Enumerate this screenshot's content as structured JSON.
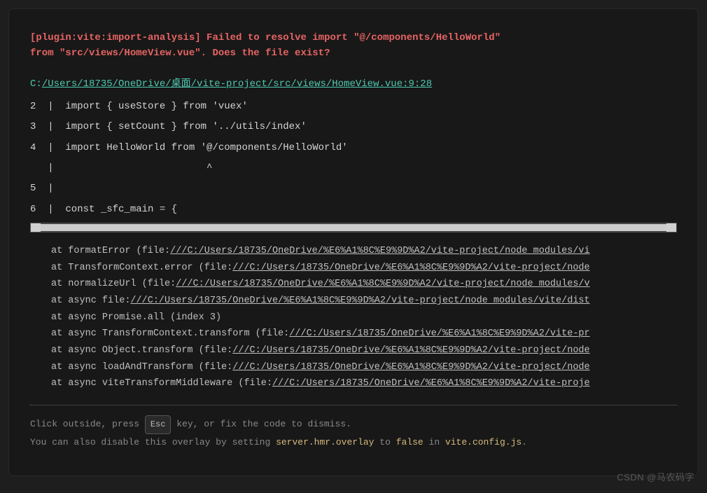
{
  "header": {
    "plugin_tag": "[plugin:vite:import-analysis]",
    "error_line1": " Failed to resolve import \"@/components/HelloWorld\"",
    "error_line2": "from \"src/views/HomeView.vue\". Does the file exist?"
  },
  "file": {
    "drive": "C:",
    "path": "/Users/18735/OneDrive/桌面/vite-project/src/views/HomeView.vue:9:28"
  },
  "code_frame": [
    {
      "num": "2",
      "text": "  import { useStore } from 'vuex'"
    },
    {
      "num": "3",
      "text": "  import { setCount } from '../utils/index'"
    },
    {
      "num": "4",
      "text": "  import HelloWorld from '@/components/HelloWorld'"
    },
    {
      "num": "",
      "text": "                          ^"
    },
    {
      "num": "5",
      "text": "  "
    },
    {
      "num": "6",
      "text": "  const _sfc_main = {"
    }
  ],
  "stack": [
    {
      "prefix": "at formatError (file:",
      "link": "///C:/Users/18735/OneDrive/%E6%A1%8C%E9%9D%A2/vite-project/node_modules/vi",
      "suffix": ""
    },
    {
      "prefix": "at TransformContext.error (file:",
      "link": "///C:/Users/18735/OneDrive/%E6%A1%8C%E9%9D%A2/vite-project/node",
      "suffix": ""
    },
    {
      "prefix": "at normalizeUrl (file:",
      "link": "///C:/Users/18735/OneDrive/%E6%A1%8C%E9%9D%A2/vite-project/node_modules/v",
      "suffix": ""
    },
    {
      "prefix": "at async file:",
      "link": "///C:/Users/18735/OneDrive/%E6%A1%8C%E9%9D%A2/vite-project/node_modules/vite/dist",
      "suffix": ""
    },
    {
      "prefix": "at async Promise.all (index 3)",
      "link": "",
      "suffix": ""
    },
    {
      "prefix": "at async TransformContext.transform (file:",
      "link": "///C:/Users/18735/OneDrive/%E6%A1%8C%E9%9D%A2/vite-pr",
      "suffix": ""
    },
    {
      "prefix": "at async Object.transform (file:",
      "link": "///C:/Users/18735/OneDrive/%E6%A1%8C%E9%9D%A2/vite-project/node",
      "suffix": ""
    },
    {
      "prefix": "at async loadAndTransform (file:",
      "link": "///C:/Users/18735/OneDrive/%E6%A1%8C%E9%9D%A2/vite-project/node",
      "suffix": ""
    },
    {
      "prefix": "at async viteTransformMiddleware (file:",
      "link": "///C:/Users/18735/OneDrive/%E6%A1%8C%E9%9D%A2/vite-proje",
      "suffix": ""
    }
  ],
  "tips": {
    "line1_a": "Click outside, press ",
    "esc": "Esc",
    "line1_b": " key, or fix the code to dismiss.",
    "line2_a": "You can also disable this overlay by setting ",
    "code1": "server.hmr.overlay",
    "line2_b": " to ",
    "code2": "false",
    "line2_c": " in ",
    "code3": "vite.config.js",
    "line2_d": "."
  },
  "watermark": "CSDN @马农码字"
}
